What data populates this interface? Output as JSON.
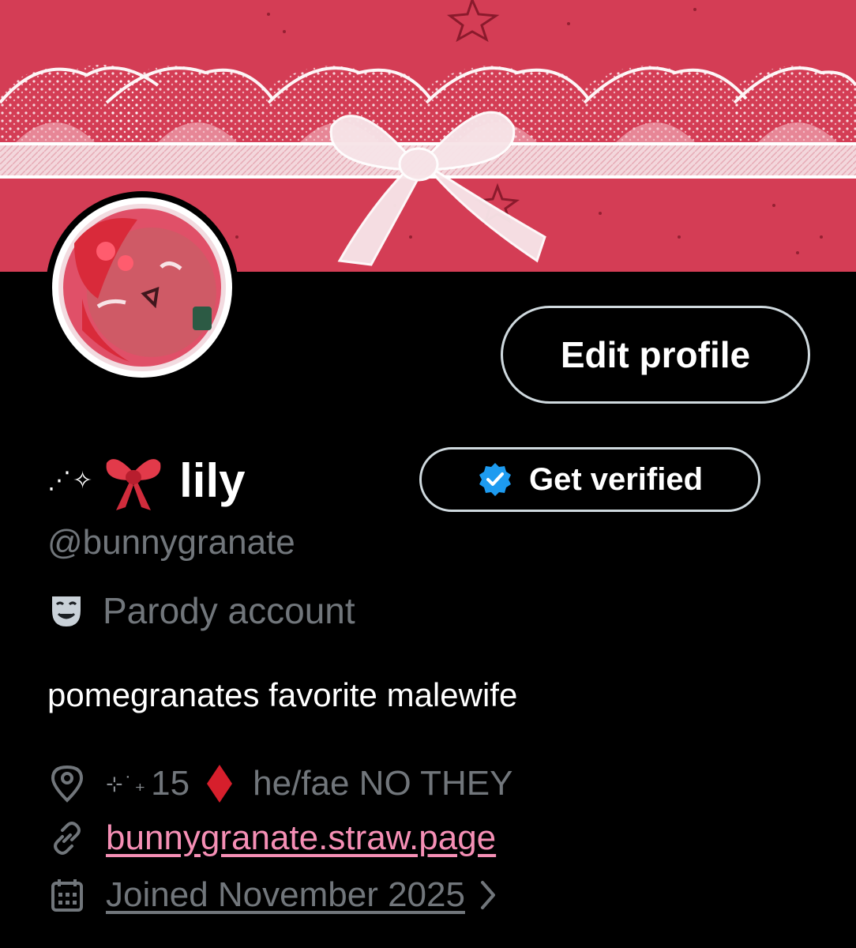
{
  "colors": {
    "background": "#000000",
    "banner": "#d43d55",
    "muted_text": "#71767b",
    "link": "#f58fb5",
    "verified_blue": "#1d9bf0"
  },
  "profile": {
    "name_prefix": "⋰✧",
    "display_name": "lily",
    "handle": "@bunnygranate",
    "parody_label": "Parody account",
    "bio": "pomegranates favorite malewife"
  },
  "buttons": {
    "edit_profile": "Edit profile",
    "get_verified": "Get verified"
  },
  "meta": {
    "location_prefix": "⊹˙₊",
    "location_number": "15",
    "location_pronouns": "he/fae NO THEY",
    "website": "bunnygranate.straw.page",
    "joined": "Joined November 2025"
  },
  "icons": {
    "bow": "red-bow-emoji",
    "parody": "theater-mask-icon",
    "location": "location-pin-icon",
    "link": "link-icon",
    "calendar": "calendar-icon",
    "diamond": "red-diamond-emoji",
    "verified": "verified-badge-icon"
  }
}
